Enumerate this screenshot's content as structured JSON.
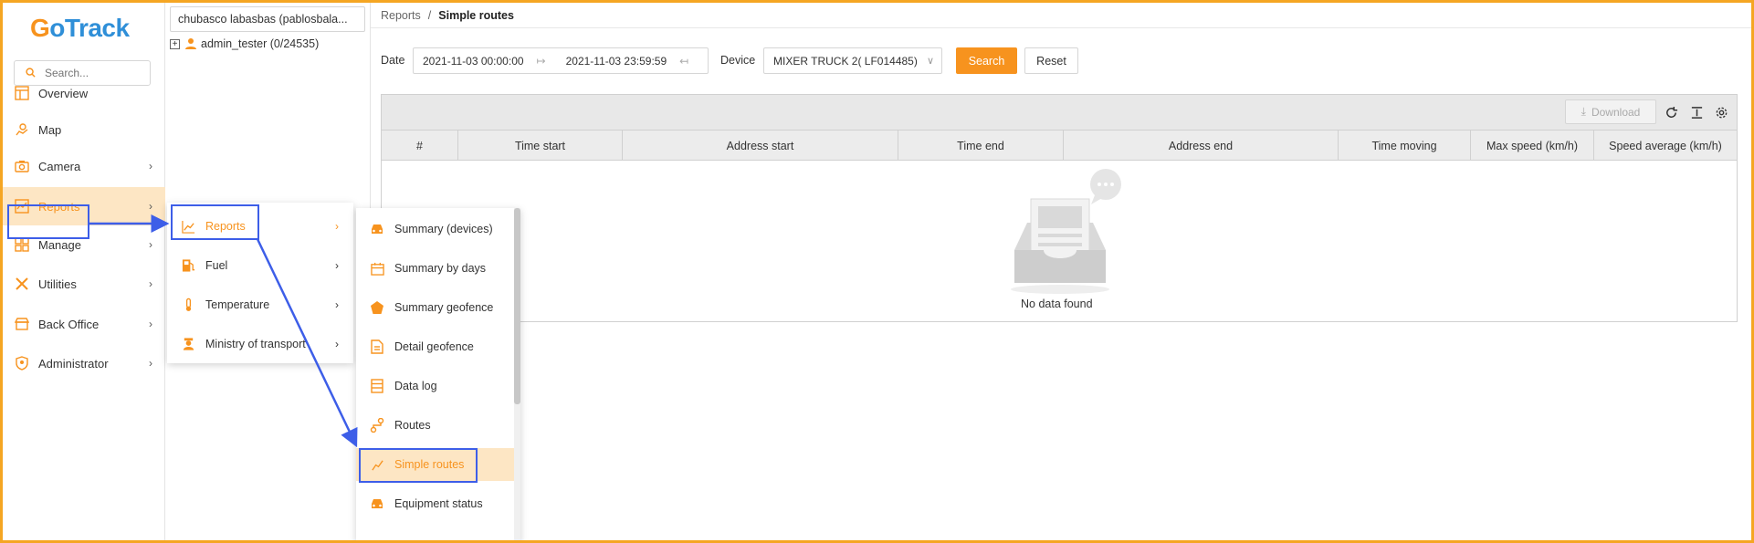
{
  "app": {
    "logo_g": "G",
    "logo_rest": "oTrack"
  },
  "search": {
    "placeholder": "Search..."
  },
  "sidebar": {
    "items": [
      {
        "label": "Overview",
        "icon": "overview-icon"
      },
      {
        "label": "Map",
        "icon": "map-icon"
      },
      {
        "label": "Camera",
        "icon": "camera-icon"
      },
      {
        "label": "Reports",
        "icon": "reports-icon",
        "active": true
      },
      {
        "label": "Manage",
        "icon": "manage-icon"
      },
      {
        "label": "Utilities",
        "icon": "utilities-icon"
      },
      {
        "label": "Back Office",
        "icon": "back-office-icon"
      },
      {
        "label": "Administrator",
        "icon": "administrator-icon"
      }
    ]
  },
  "tree": {
    "account": "chubasco labasbas (pablosbala...",
    "node_label": "admin_tester (0/24535)"
  },
  "breadcrumb": {
    "parent": "Reports",
    "separator": "/",
    "current": "Simple routes"
  },
  "filters": {
    "date_label": "Date",
    "date_start": "2021-11-03 00:00:00",
    "date_end": "2021-11-03 23:59:59",
    "device_label": "Device",
    "device_value": "MIXER TRUCK 2( LF014485)",
    "search_label": "Search",
    "reset_label": "Reset"
  },
  "table": {
    "download_label": "Download",
    "columns": [
      "#",
      "Time start",
      "Address start",
      "Time end",
      "Address end",
      "Time moving",
      "Max speed (km/h)",
      "Speed average (km/h)"
    ],
    "empty_text": "No data found"
  },
  "submenu1": {
    "items": [
      {
        "label": "Reports",
        "icon": "chart-line-icon"
      },
      {
        "label": "Fuel",
        "icon": "fuel-icon"
      },
      {
        "label": "Temperature",
        "icon": "thermometer-icon"
      },
      {
        "label": "Ministry of transport",
        "icon": "officer-icon"
      }
    ]
  },
  "submenu2": {
    "items": [
      {
        "label": "Summary (devices)",
        "icon": "car-icon"
      },
      {
        "label": "Summary by days",
        "icon": "calendar-icon"
      },
      {
        "label": "Summary geofence",
        "icon": "pentagon-icon"
      },
      {
        "label": "Detail geofence",
        "icon": "document-icon"
      },
      {
        "label": "Data log",
        "icon": "list-icon"
      },
      {
        "label": "Routes",
        "icon": "route-icon"
      },
      {
        "label": "Simple routes",
        "icon": "chart-line-icon"
      },
      {
        "label": "Equipment status",
        "icon": "car-icon"
      }
    ]
  },
  "colors": {
    "accent": "#f7931e",
    "brand_blue": "#2f8fd8",
    "highlight": "#3d5ee8",
    "active_bg": "#fde6c4"
  }
}
